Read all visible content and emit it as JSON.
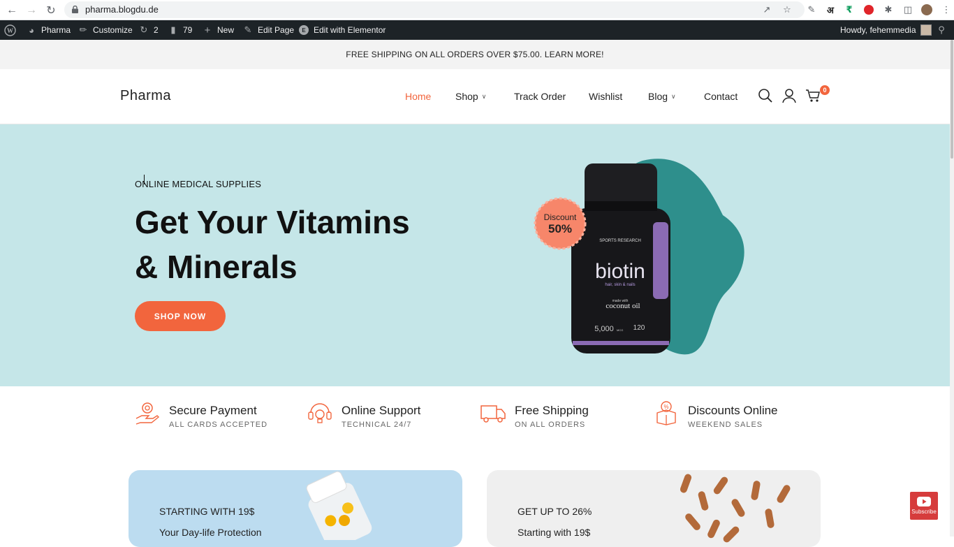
{
  "browser": {
    "url": "pharma.blogdu.de"
  },
  "wp_admin": {
    "site_name": "Pharma",
    "customize": "Customize",
    "updates_count": "2",
    "comments_count": "79",
    "new": "New",
    "edit_page": "Edit Page",
    "edit_elementor": "Edit with Elementor",
    "howdy": "Howdy, fehemmedia"
  },
  "promo_bar": "FREE SHIPPING ON ALL ORDERS OVER $75.00. LEARN MORE!",
  "header": {
    "logo": "Pharma",
    "menu": [
      "Home",
      "Shop",
      "Track Order",
      "Wishlist",
      "Blog",
      "Contact"
    ],
    "cart_count": "0"
  },
  "hero": {
    "eyebrow": "ONLINE MEDICAL SUPPLIES",
    "title_line1": "Get Your Vitamins",
    "title_line2": "& Minerals",
    "button": "SHOP NOW",
    "discount_label": "Discount",
    "discount_value": "50%",
    "product_brand": "SPORTS RESEARCH",
    "product_name": "biotin",
    "product_tagline": "hair, skin & nails",
    "product_made": "made with",
    "product_oil": "coconut oil",
    "product_dose": "5,000",
    "product_unit": "MCG",
    "product_count": "120"
  },
  "features": [
    {
      "title": "Secure Payment",
      "subtitle": "ALL CARDS ACCEPTED",
      "icon": "payment-icon"
    },
    {
      "title": "Online Support",
      "subtitle": "TECHNICAL 24/7",
      "icon": "support-icon"
    },
    {
      "title": "Free Shipping",
      "subtitle": "ON ALL ORDERS",
      "icon": "truck-icon"
    },
    {
      "title": "Discounts Online",
      "subtitle": "WEEKEND SALES",
      "icon": "gift-icon"
    }
  ],
  "cards": [
    {
      "line1": "STARTING WITH 19$",
      "line2": "Your Day-life Protection"
    },
    {
      "line1": "GET UP TO 26%",
      "line2": "Starting with 19$"
    }
  ],
  "youtube": "Subscribe",
  "colors": {
    "accent": "#f2653d",
    "hero_bg": "#c5e6e8",
    "blob": "#2e8f8c",
    "wp_bar": "#1d2327"
  }
}
